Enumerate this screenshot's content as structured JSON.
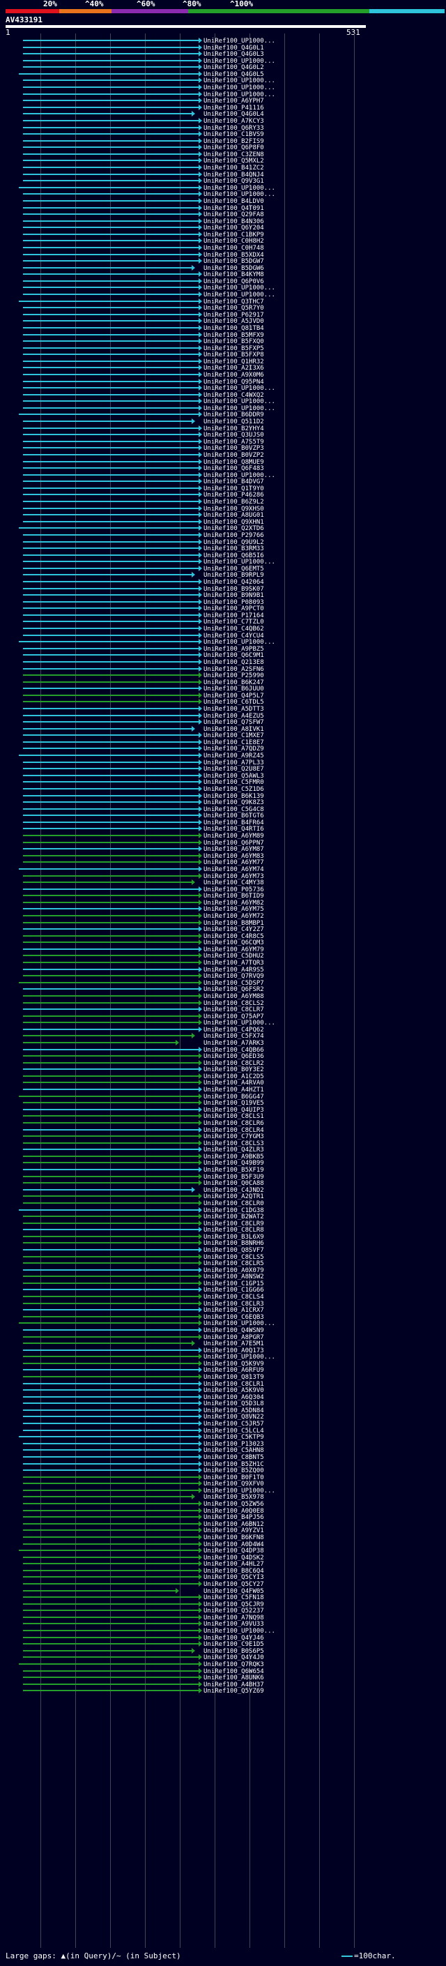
{
  "scale": {
    "labels": [
      "20%",
      "^40%",
      "^60%",
      "^80%",
      "^100%"
    ],
    "colors": [
      "#e0121e",
      "#e8731c",
      "#8c2bb0",
      "#24a02a",
      "#2ec4dc"
    ]
  },
  "query": {
    "id": "AV433191",
    "start": "1",
    "end": "531"
  },
  "legend": {
    "text": "Large gaps: ▲(in Query)/~ (in Subject)",
    "scale_text": "=100char."
  },
  "hits": [
    "UniRef100_UP1000...",
    "UniRef100_Q4G0L1",
    "UniRef100_Q4G0L3",
    "UniRef100_UP1000...",
    "UniRef100_Q4G0L2",
    "UniRef100_Q4G0L5",
    "UniRef100_UP1000...",
    "UniRef100_UP1000...",
    "UniRef100_UP1000...",
    "UniRef100_A6YPH7",
    "UniRef100_P41116",
    "UniRef100_Q4G0L4",
    "UniRef100_A7KCY3",
    "UniRef100_Q6RY33",
    "UniRef100_C1BVS9",
    "UniRef100_B2FIS9",
    "UniRef100_Q6P8F0",
    "UniRef100_C3ZEN8",
    "UniRef100_Q5MXL2",
    "UniRef100_B41ZC2",
    "UniRef100_B4QNJ4",
    "UniRef100_Q9V3G1",
    "UniRef100_UP1000...",
    "UniRef100_UP1000...",
    "UniRef100_B4LDV0",
    "UniRef100_Q4T091",
    "UniRef100_Q29FA8",
    "UniRef100_B4N306",
    "UniRef100_Q6Y204",
    "UniRef100_C1BKP9",
    "UniRef100_C0H8H2",
    "UniRef100_C0H748",
    "UniRef100_B5XDX4",
    "UniRef100_B5DGW7",
    "UniRef100_B5DGW6",
    "UniRef100_B4KYM8",
    "UniRef100_Q6P0V6",
    "UniRef100_UP1000...",
    "UniRef100_UP1000...",
    "UniRef100_Q3THC7",
    "UniRef100_Q5R7Y0",
    "UniRef100_P62917",
    "UniRef100_A5JVD0",
    "UniRef100_Q81TB4",
    "UniRef100_B5MFX9",
    "UniRef100_B5FXQ0",
    "UniRef100_B5FXP5",
    "UniRef100_B5FXP8",
    "UniRef100_Q1HR32",
    "UniRef100_A2I3X6",
    "UniRef100_A9X0M6",
    "UniRef100_Q95PN4",
    "UniRef100_UP1000...",
    "UniRef100_C4WXQ2",
    "UniRef100_UP1000...",
    "UniRef100_UP1000...",
    "UniRef100_B6DDR9",
    "UniRef100_Q511D2",
    "UniRef100_B2YHY4",
    "UniRef100_Q3UJS0",
    "UniRef100_A7S5T9",
    "UniRef100_B0VZP3",
    "UniRef100_B0VZP2",
    "UniRef100_Q8MUE9",
    "UniRef100_Q6F483",
    "UniRef100_UP1000...",
    "UniRef100_B4DVG7",
    "UniRef100_Q1T9Y0",
    "UniRef100_P46286",
    "UniRef100_B6Z9L2",
    "UniRef100_Q9XHS0",
    "UniRef100_A8UG01",
    "UniRef100_Q9XHN1",
    "UniRef100_Q2XTD6",
    "UniRef100_P29766",
    "UniRef100_Q9U9L2",
    "UniRef100_B3RM33",
    "UniRef100_Q6B5I6",
    "UniRef100_UP1000...",
    "UniRef100_Q6EMT5",
    "UniRef100_B9RPL9",
    "UniRef100_Q42064",
    "UniRef100_B9SK07",
    "UniRef100_B9N9B1",
    "UniRef100_P08093",
    "UniRef100_A9PCT0",
    "UniRef100_P17164",
    "UniRef100_C7TZL0",
    "UniRef100_C4QB62",
    "UniRef100_C4YCU4",
    "UniRef100_UP1000...",
    "UniRef100_A9PBZ5",
    "UniRef100_Q6C9M1",
    "UniRef100_Q213E8",
    "UniRef100_A2SFN6",
    "UniRef100_P25990",
    "UniRef100_B6K247",
    "UniRef100_B6JUU0",
    "UniRef100_Q4P5L7",
    "UniRef100_C6TDL5",
    "UniRef100_A5DTT3",
    "UniRef100_A4EZU5",
    "UniRef100_Q7SFW7",
    "UniRef100_A8IVK1",
    "UniRef100_C1MXE7",
    "UniRef100_C1E8E7",
    "UniRef100_A7QDZ9",
    "UniRef100_A9RZ45",
    "UniRef100_A7PL33",
    "UniRef100_Q2U8E7",
    "UniRef100_Q5AWL3",
    "UniRef100_C5FMR0",
    "UniRef100_C5Z1D6",
    "UniRef100_B6K139",
    "UniRef100_Q9K8Z3",
    "UniRef100_C5G4C8",
    "UniRef100_B6TGT6",
    "UniRef100_B4FR64",
    "UniRef100_Q4RTI6",
    "UniRef100_A6YM89",
    "UniRef100_Q6PPN7",
    "UniRef100_A6YM87",
    "UniRef100_A6YM83",
    "UniRef100_A6YM77",
    "UniRef100_A6YM74",
    "UniRef100_A6YM73",
    "UniRef100_C4MY38",
    "UniRef100_P05736",
    "UniRef100_B6TID9",
    "UniRef100_A6YM82",
    "UniRef100_A6YM75",
    "UniRef100_A6YM72",
    "UniRef100_B8MBP1",
    "UniRef100_C4Y2Z7",
    "UniRef100_C4R8C5",
    "UniRef100_Q6CQM3",
    "UniRef100_A6YM79",
    "UniRef100_C5DHU2",
    "UniRef100_A7TQR3",
    "UniRef100_A4R9S5",
    "UniRef100_Q7RVQ9",
    "UniRef100_C5DSP7",
    "UniRef100_Q6FSR2",
    "UniRef100_A6YM88",
    "UniRef100_C8CLS2",
    "UniRef100_C8CLR7",
    "UniRef100_Q75AP7",
    "UniRef100_UP1000...",
    "UniRef100_C4PQ62",
    "UniRef100_C5FX74",
    "UniRef100_A7ARK3",
    "UniRef100_C4QB66",
    "UniRef100_Q6ED36",
    "UniRef100_C8CLR2",
    "UniRef100_B0Y3E2",
    "UniRef100_A1C2D5",
    "UniRef100_A4RVA0",
    "UniRef100_A4HZT1",
    "UniRef100_B6GG47",
    "UniRef100_Q19VE5",
    "UniRef100_Q4UIP3",
    "UniRef100_C8CLS1",
    "UniRef100_C8CLR6",
    "UniRef100_C8CLR4",
    "UniRef100_C7YGM3",
    "UniRef100_C8CLS3",
    "UniRef100_Q4ZLR3",
    "UniRef100_A9BKB5",
    "UniRef100_Q49B99",
    "UniRef100_B5XF19",
    "UniRef100_B5F3U9",
    "UniRef100_Q0CA88",
    "UniRef100_C4JND2",
    "UniRef100_A2QTR1",
    "UniRef100_C8CLR0",
    "UniRef100_C1DG38",
    "UniRef100_B2WAT2",
    "UniRef100_C8CLR9",
    "UniRef100_C8CLR8",
    "UniRef100_B3L6X9",
    "UniRef100_B8NRH6",
    "UniRef100_Q8SVF7",
    "UniRef100_C8CLS5",
    "UniRef100_C8CLR5",
    "UniRef100_A0X079",
    "UniRef100_A8NSW2",
    "UniRef100_C1GP15",
    "UniRef100_C1GG66",
    "UniRef100_C8CLS4",
    "UniRef100_C8CLR3",
    "UniRef100_A1CRX7",
    "UniRef100_C6EQB3",
    "UniRef100_UP1000...",
    "UniRef100_Q4WSN9",
    "UniRef100_A8PGR7",
    "UniRef100_A7E5M1",
    "UniRef100_A0Q173",
    "UniRef100_UP1000...",
    "UniRef100_Q5K9V9",
    "UniRef100_A6RFU9",
    "UniRef100_Q813T9",
    "UniRef100_C8CLR1",
    "UniRef100_A5K9V0",
    "UniRef100_A6Q304",
    "UniRef100_Q5D3L8",
    "UniRef100_A5DN84",
    "UniRef100_Q8VN22",
    "UniRef100_C5JR57",
    "UniRef100_C5LCL4",
    "UniRef100_C5KTP9",
    "UniRef100_P13023",
    "UniRef100_C5AHN8",
    "UniRef100_C8BNT5",
    "UniRef100_B5ZH1C",
    "UniRef100_B5ZQ00",
    "UniRef100_B0F1T0",
    "UniRef100_Q9XFV0",
    "UniRef100_UP1000...",
    "UniRef100_B5X978",
    "UniRef100_Q5ZW56",
    "UniRef100_A0Q0E8",
    "UniRef100_B4PJ56",
    "UniRef100_A6BN12",
    "UniRef100_A9YZV1",
    "UniRef100_B6KFN8",
    "UniRef100_A0D4W4",
    "UniRef100_Q4DP38",
    "UniRef100_Q4DSK2",
    "UniRef100_A4HL27",
    "UniRef100_B8C6Q4",
    "UniRef100_Q5CYI3",
    "UniRef100_Q5CY27",
    "UniRef100_Q4FW05",
    "UniRef100_C5FN18",
    "UniRef100_Q5CJR9",
    "UniRef100_Q52237",
    "UniRef100_A7NQ98",
    "UniRef100_A9VU33",
    "UniRef100_UP1000...",
    "UniRef100_Q4YJ46",
    "UniRef100_C9E1D5",
    "UniRef100_B0S6P5",
    "UniRef100_Q4Y4J0",
    "UniRef100_Q7RQK3",
    "UniRef100_Q6W654",
    "UniRef100_A8UNK6",
    "UniRef100_A4BH37",
    "UniRef100_Q5YZ69"
  ]
}
